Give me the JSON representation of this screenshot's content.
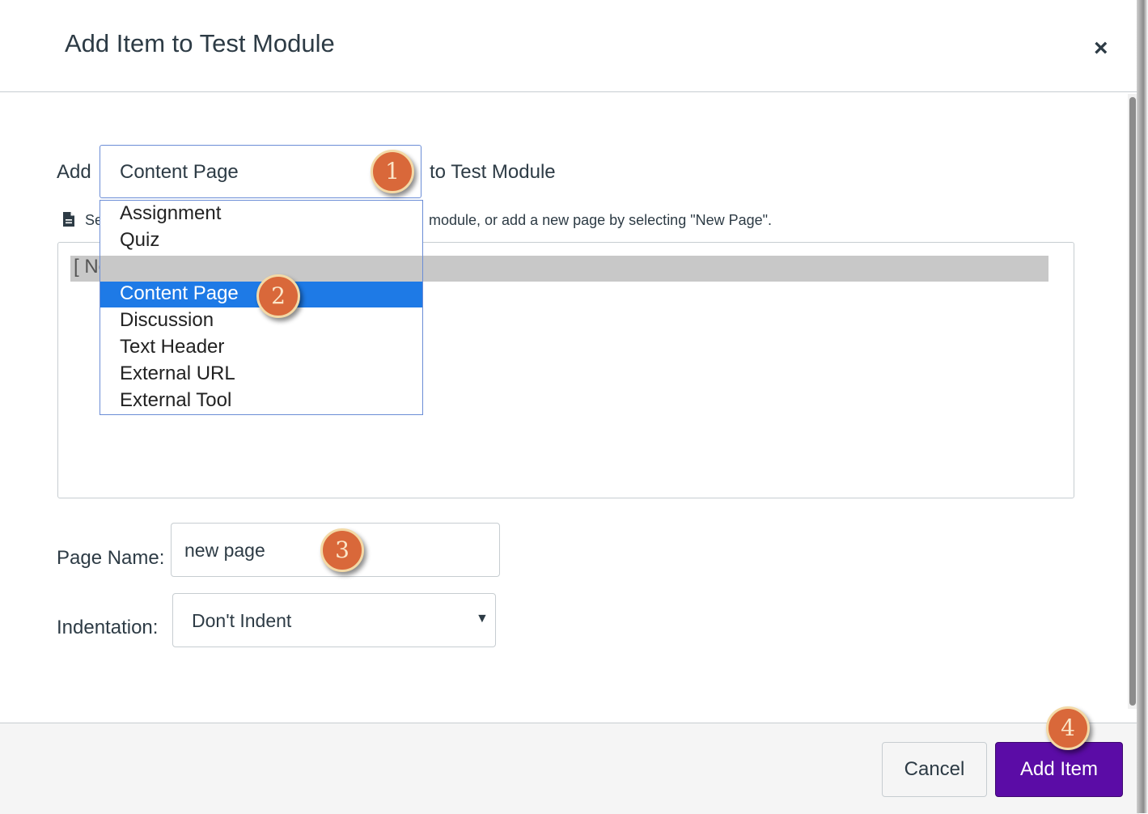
{
  "dialog": {
    "title": "Add Item to Test Module",
    "close_symbol": "×"
  },
  "add_row": {
    "add_label": "Add",
    "selected_type": "Content Page",
    "to_label": "to Test Module"
  },
  "description": {
    "icon": "document-icon",
    "visible_start": "Se",
    "visible_end": "module, or add a new page by selecting \"New Page\"."
  },
  "page_list": {
    "highlighted_option": "[ New Page ]"
  },
  "type_dropdown": {
    "options": [
      "Assignment",
      "Quiz",
      "Content Page",
      "Discussion",
      "Text Header",
      "External URL",
      "External Tool"
    ],
    "selected_index": 2
  },
  "page_name": {
    "label": "Page Name:",
    "value": "new page"
  },
  "indentation": {
    "label": "Indentation:",
    "value": "Don't Indent",
    "arrow": "▼"
  },
  "footer": {
    "cancel_label": "Cancel",
    "add_label": "Add Item"
  },
  "badges": [
    "1",
    "2",
    "3",
    "4"
  ],
  "colors": {
    "primary_button": "#5b0ca6",
    "selection_blue": "#1e7ae6",
    "badge_fill": "#d9683a",
    "focus_border": "#6b8dd6"
  }
}
